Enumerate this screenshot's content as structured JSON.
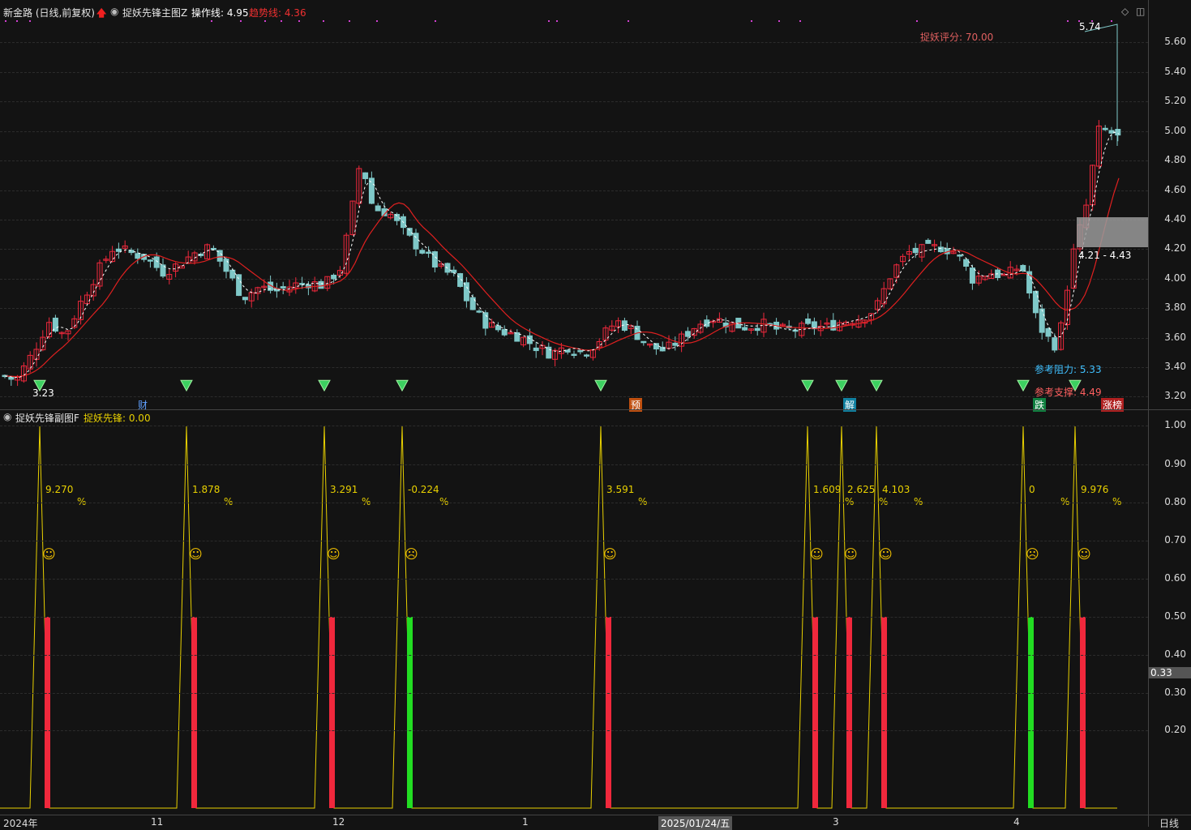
{
  "main_header": {
    "stock": "新金路 (日线,前复权)",
    "indicator": "捉妖先锋主图Z",
    "op_line_label": "操作线: 4.95",
    "trend_line_label": "趋势线: 4.36"
  },
  "score_label": "捉妖评分: 70.00",
  "high_label": "5.74",
  "low_label": "3.23",
  "zone_label": "4.21 - 4.43",
  "resistance_label": "参考阻力: 5.33",
  "support_label": "参考支撑: 4.49",
  "catch_text": "捉",
  "event_markers": [
    "财",
    "预",
    "解",
    "跌",
    "涨榜"
  ],
  "main_axis": [
    "5.60",
    "5.40",
    "5.20",
    "5.00",
    "4.80",
    "4.60",
    "4.40",
    "4.20",
    "4.00",
    "3.80",
    "3.60",
    "3.40",
    "3.20"
  ],
  "sub_header": {
    "indicator": "捉妖先锋副图F",
    "value_label": "捉妖先锋: 0.00"
  },
  "sub_axis": [
    "1.00",
    "0.90",
    "0.80",
    "0.70",
    "0.60",
    "0.50",
    "0.40",
    "0.30",
    "0.20"
  ],
  "cursor_value": "0.33",
  "signals": [
    {
      "pct": "9.270",
      "positive": true
    },
    {
      "pct": "1.878",
      "positive": true
    },
    {
      "pct": "3.291",
      "positive": true
    },
    {
      "pct": "-0.224",
      "positive": false
    },
    {
      "pct": "3.591",
      "positive": true
    },
    {
      "pct": "1.609",
      "positive": true
    },
    {
      "pct": "2.625",
      "positive": true
    },
    {
      "pct": "4.103",
      "positive": true
    },
    {
      "pct": "0",
      "positive": false
    },
    {
      "pct": "9.976",
      "positive": true
    }
  ],
  "percent_sign": "%",
  "date_axis": [
    "2024年",
    "11",
    "12",
    "1",
    "2025/01/24/五",
    "3",
    "4"
  ],
  "period_label": "日线",
  "colors": {
    "up": "#f0283c",
    "down": "#7fc8c8",
    "ma": "#e02020",
    "yellow": "#e8d000",
    "green": "#22dd22",
    "bg": "#131313"
  }
}
